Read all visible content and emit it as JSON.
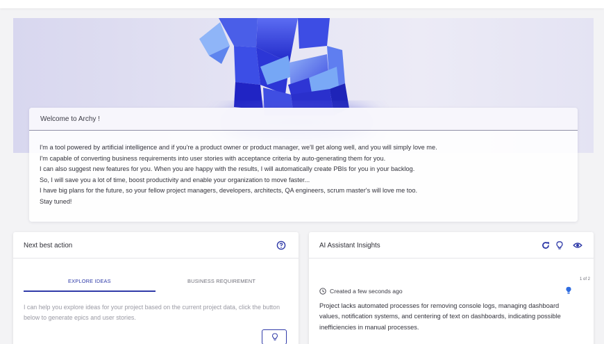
{
  "colors": {
    "accent": "#2f3aa8",
    "hero_shape_dark": "#3a3fd8",
    "hero_shape_light": "#6f8ff0",
    "insight_bulb": "#2f6ce0"
  },
  "welcome": {
    "title": "Welcome to Archy !",
    "lines": [
      "I'm a tool powered by artificial intelligence and if you're a product owner or product manager, we'll get along well, and you will simply love me.",
      "I'm capable of converting business requirements into user stories with acceptance criteria by auto-generating them for you.",
      "I can also suggest new features for you. When you are happy with the results, I will automatically create PBIs for you in your backlog.",
      "So, I will save you a lot of time, boost productivity and enable your organization to move faster...",
      "I have big plans for the future, so your fellow project managers, developers, architects, QA engineers, scrum master's will love me too.",
      "Stay tuned!"
    ]
  },
  "next_best_action": {
    "title": "Next best action",
    "help_icon": "help-circle-icon",
    "tabs": [
      {
        "label": "EXPLORE IDEAS",
        "active": true
      },
      {
        "label": "BUSINESS REQUIREMENT",
        "active": false
      }
    ],
    "description": "I can help you explore ideas for your project based on the current project data, click the button below to generate epics and user stories.",
    "generate_icon": "lightbulb-icon"
  },
  "ai_insights": {
    "title": "AI Assistant Insights",
    "header_icons": [
      "refresh-icon",
      "lightbulb-icon",
      "eye-icon"
    ],
    "pager": "1 of 2",
    "created": "Created a few seconds ago",
    "text": "Project lacks automated processes for removing console logs, managing dashboard values, notification systems, and centering of text on dashboards, indicating possible inefficiencies in manual processes."
  }
}
